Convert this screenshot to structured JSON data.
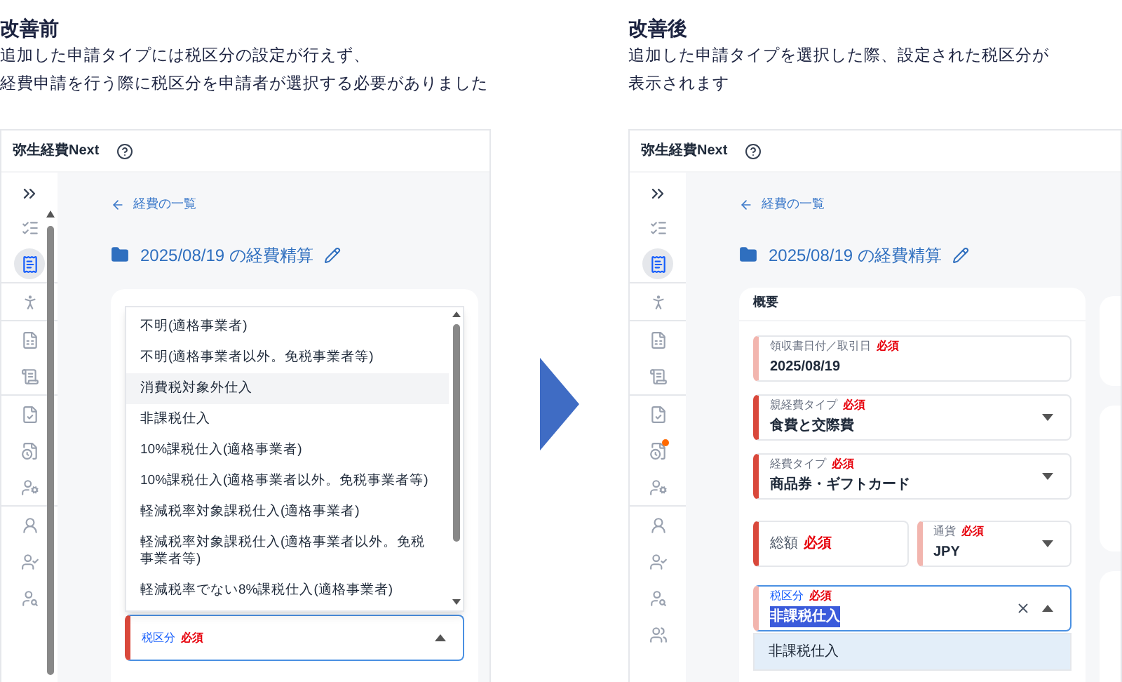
{
  "before": {
    "heading": "改善前",
    "description": [
      "追加した申請タイプには税区分の設定が行えず、",
      "経費申請を行う際に税区分を申請者が選択する必要がありました"
    ],
    "app": {
      "title": "弥生経費Next",
      "scrollbar": true,
      "sidebar_groups": [
        {
          "items": [
            {
              "kind": "checklist",
              "selected": false,
              "badge": false
            },
            {
              "kind": "receipt",
              "selected": true,
              "badge": false
            }
          ]
        },
        {
          "items": [
            {
              "kind": "walker",
              "selected": false,
              "badge": false
            }
          ]
        },
        {
          "items": [
            {
              "kind": "calc-doc",
              "selected": false,
              "badge": false
            },
            {
              "kind": "scroll",
              "selected": false,
              "badge": false
            }
          ]
        },
        {
          "items": [
            {
              "kind": "doc-check",
              "selected": false,
              "badge": false
            },
            {
              "kind": "doc-clock",
              "selected": false,
              "badge": false
            },
            {
              "kind": "person-gear",
              "selected": false,
              "badge": false
            }
          ]
        },
        {
          "items": [
            {
              "kind": "user-doc",
              "selected": false,
              "badge": false
            },
            {
              "kind": "user-check",
              "selected": false,
              "badge": false
            },
            {
              "kind": "user-search",
              "selected": false,
              "badge": false
            }
          ]
        }
      ],
      "back_link": "経費の一覧",
      "page_title": "2025/08/19 の経費精算",
      "options": [
        {
          "label": "不明(適格事業者)",
          "hovered": false
        },
        {
          "label": "不明(適格事業者以外。免税事業者等)",
          "hovered": false
        },
        {
          "label": "消費税対象外仕入",
          "hovered": true
        },
        {
          "label": "非課税仕入",
          "hovered": false
        },
        {
          "label": "10%課税仕入(適格事業者)",
          "hovered": false
        },
        {
          "label": "10%課税仕入(適格事業者以外。免税事業者等)",
          "hovered": false
        },
        {
          "label": "軽減税率対象課税仕入(適格事業者)",
          "hovered": false
        },
        {
          "label": "軽減税率対象課税仕入(適格事業者以外。免税事業者等)",
          "hovered": false
        },
        {
          "label": "軽減税率でない8%課税仕入(適格事業者)",
          "hovered": false
        }
      ],
      "field": {
        "kind": "combobox",
        "label": "税区分",
        "required": "必須",
        "focused": true,
        "expanded": true,
        "emphasized": true
      }
    }
  },
  "after": {
    "heading": "改善後",
    "description": [
      "追加した申請タイプを選択した際、設定された税区分が",
      "表示されます"
    ],
    "app": {
      "title": "弥生経費Next",
      "sidebar_groups": [
        {
          "items": [
            {
              "kind": "checklist",
              "selected": false,
              "badge": false
            },
            {
              "kind": "receipt",
              "selected": true,
              "badge": false
            }
          ]
        },
        {
          "items": [
            {
              "kind": "walker",
              "selected": false,
              "badge": false
            }
          ]
        },
        {
          "items": [
            {
              "kind": "calc-doc",
              "selected": false,
              "badge": false
            },
            {
              "kind": "scroll",
              "selected": false,
              "badge": false
            }
          ]
        },
        {
          "items": [
            {
              "kind": "doc-check",
              "selected": false,
              "badge": false
            },
            {
              "kind": "doc-clock",
              "selected": false,
              "badge": true
            },
            {
              "kind": "person-gear",
              "selected": false,
              "badge": false
            }
          ]
        },
        {
          "items": [
            {
              "kind": "user-doc",
              "selected": false,
              "badge": false
            },
            {
              "kind": "user-check",
              "selected": false,
              "badge": false
            },
            {
              "kind": "user-search",
              "selected": false,
              "badge": false
            },
            {
              "kind": "user-group",
              "selected": false,
              "badge": false
            }
          ]
        }
      ],
      "back_link": "経費の一覧",
      "page_title": "2025/08/19 の経費精算",
      "card_title": "概要",
      "rows": [
        [
          {
            "kind": "text",
            "label": "領収書日付／取引日",
            "required": "必須",
            "value": "2025/08/19",
            "emphasized": false,
            "focused": false
          }
        ],
        [
          {
            "kind": "select",
            "label": "親経費タイプ",
            "required": "必須",
            "value": "食費と交際費",
            "emphasized": true,
            "focused": false,
            "expanded": false
          }
        ],
        [
          {
            "kind": "select",
            "label": "経費タイプ",
            "required": "必須",
            "value": "商品券・ギフトカード",
            "emphasized": true,
            "focused": false,
            "expanded": false
          }
        ],
        [
          {
            "kind": "inline",
            "label": "総額",
            "required": "必須",
            "emphasized": true,
            "focused": false
          },
          {
            "kind": "select",
            "label": "通貨",
            "required": "必須",
            "value": "JPY",
            "emphasized": false,
            "focused": false,
            "expanded": false
          }
        ],
        [
          {
            "kind": "combobox",
            "label": "税区分",
            "required": "必須",
            "value": "非課税仕入",
            "value_highlighted": true,
            "emphasized": false,
            "focused": true,
            "expanded": true
          }
        ]
      ],
      "options": [
        {
          "label": "非課税仕入",
          "selected": true
        }
      ]
    }
  }
}
